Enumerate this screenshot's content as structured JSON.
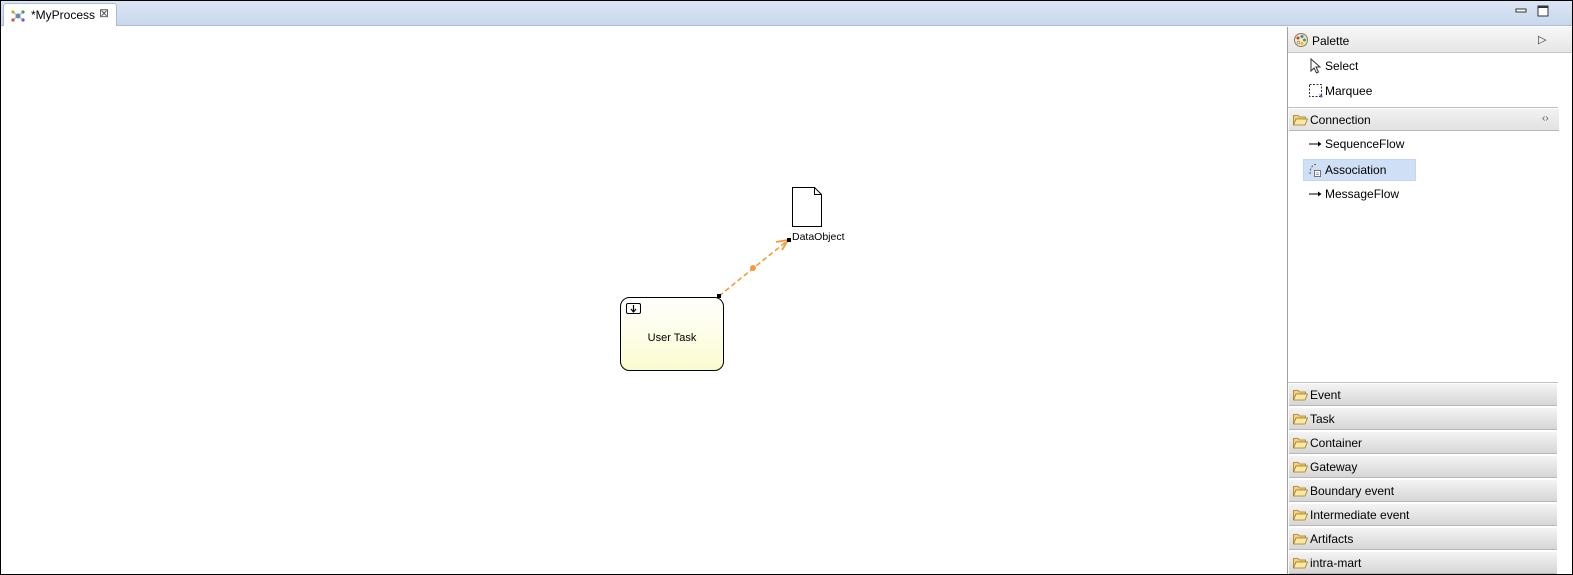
{
  "editor": {
    "tab_title": "*MyProcess",
    "tab_close": "⊠",
    "minimize_icon": "minimize-icon",
    "maximize_icon": "maximize-icon"
  },
  "diagram": {
    "task_label": "User Task",
    "data_object_label": "DataObject",
    "connection_color": "#f39a3a",
    "task_fill_top": "#ffffff",
    "task_fill_bottom": "#fbfbd0"
  },
  "palette": {
    "title": "Palette",
    "collapse_glyph": "▷",
    "tools": [
      {
        "label": "Select",
        "icon": "arrow-pointer-icon"
      },
      {
        "label": "Marquee",
        "icon": "marquee-icon"
      }
    ],
    "connection_drawer": {
      "label": "Connection",
      "pin_glyph": "‹›",
      "items": [
        {
          "label": "SequenceFlow",
          "icon": "arrow-right-icon"
        },
        {
          "label": "Association",
          "icon": "association-icon",
          "selected": true
        },
        {
          "label": "MessageFlow",
          "icon": "arrow-right-icon"
        }
      ]
    },
    "drawers": [
      "Event",
      "Task",
      "Container",
      "Gateway",
      "Boundary event",
      "Intermediate event",
      "Artifacts",
      "intra-mart"
    ]
  }
}
